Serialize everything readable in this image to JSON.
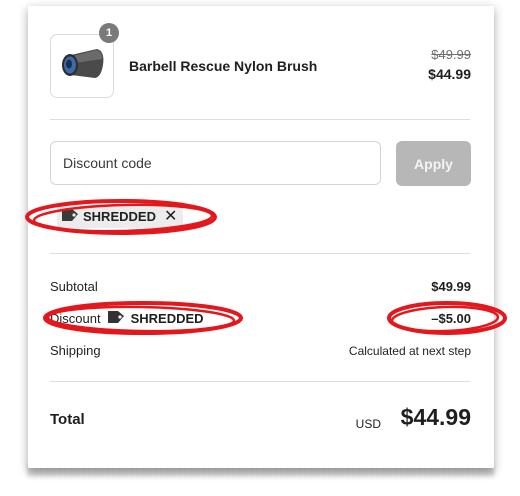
{
  "product": {
    "quantity": "1",
    "name": "Barbell Rescue Nylon Brush",
    "original_price": "$49.99",
    "price": "$44.99"
  },
  "discount": {
    "placeholder": "Discount code",
    "apply_label": "Apply",
    "applied_code": "SHREDDED",
    "remove_icon": "close-icon"
  },
  "summary": {
    "subtotal_label": "Subtotal",
    "subtotal_value": "$49.99",
    "discount_label": "Discount",
    "discount_code": "SHREDDED",
    "discount_value": "–$5.00",
    "shipping_label": "Shipping",
    "shipping_value": "Calculated at next step"
  },
  "total": {
    "label": "Total",
    "currency": "USD",
    "value": "$44.99"
  },
  "colors": {
    "annotation": "#e3171c",
    "apply_disabled": "#b7b7b7",
    "quantity_badge": "#7a7a7a"
  }
}
